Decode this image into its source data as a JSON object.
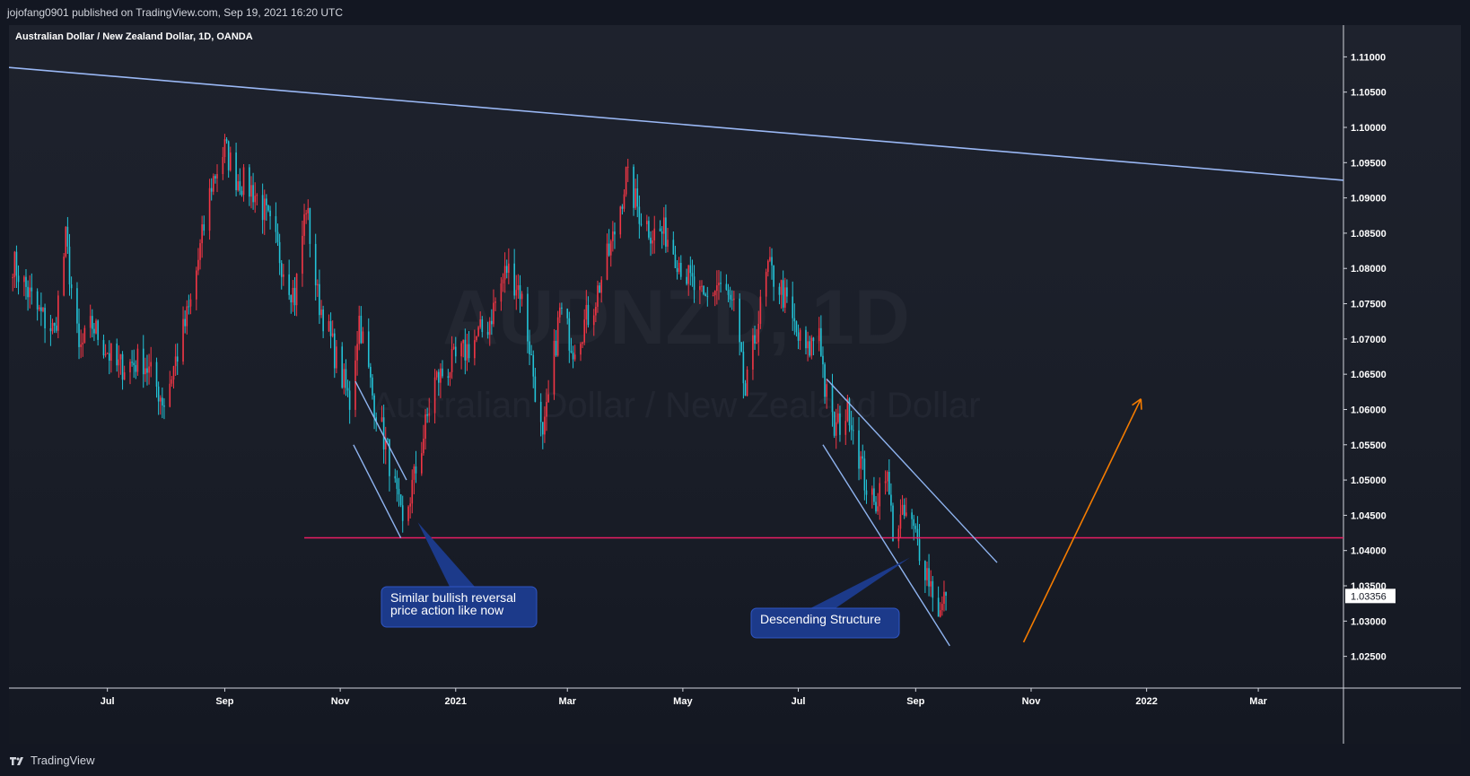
{
  "header": {
    "publish_info": "jojofang0901 published on TradingView.com, Sep 19, 2021 16:20 UTC"
  },
  "footer": {
    "brand": "TradingView"
  },
  "chart_data": {
    "type": "candlestick",
    "title": "Australian Dollar / New Zealand Dollar, 1D, OANDA",
    "watermark_symbol": "AUDNZD, 1D",
    "watermark_name": "Australian Dollar / New Zealand Dollar",
    "x_axis": {
      "ticks": [
        {
          "label": "Jul",
          "date": "2020-07-01"
        },
        {
          "label": "Sep",
          "date": "2020-09-01"
        },
        {
          "label": "Nov",
          "date": "2020-11-01"
        },
        {
          "label": "2021",
          "date": "2021-01-01",
          "bold": true
        },
        {
          "label": "Mar",
          "date": "2021-03-01"
        },
        {
          "label": "May",
          "date": "2021-05-01"
        },
        {
          "label": "Jul",
          "date": "2021-07-01"
        },
        {
          "label": "Sep",
          "date": "2021-09-01"
        },
        {
          "label": "Nov",
          "date": "2021-11-01"
        },
        {
          "label": "2022",
          "date": "2022-01-01",
          "bold": true
        },
        {
          "label": "Mar",
          "date": "2022-03-01"
        }
      ],
      "range": [
        "2020-05-10",
        "2022-04-15"
      ]
    },
    "y_axis": {
      "ticks": [
        "1.02500",
        "1.03000",
        "1.03500",
        "1.04000",
        "1.04500",
        "1.05000",
        "1.05500",
        "1.06000",
        "1.06500",
        "1.07000",
        "1.07500",
        "1.08000",
        "1.08500",
        "1.09000",
        "1.09500",
        "1.10000",
        "1.10500",
        "1.11000"
      ],
      "range": [
        1.0205,
        1.1145
      ]
    },
    "last_price": "1.03356",
    "up_color": "#f23645",
    "down_color": "#22c2d6",
    "anchors": [
      [
        "2020-05-12",
        1.081
      ],
      [
        "2020-05-25",
        1.074
      ],
      [
        "2020-06-03",
        1.071
      ],
      [
        "2020-06-09",
        1.084
      ],
      [
        "2020-06-16",
        1.068
      ],
      [
        "2020-06-23",
        1.072
      ],
      [
        "2020-07-06",
        1.066
      ],
      [
        "2020-07-20",
        1.067
      ],
      [
        "2020-07-31",
        1.061
      ],
      [
        "2020-08-07",
        1.068
      ],
      [
        "2020-08-14",
        1.075
      ],
      [
        "2020-08-25",
        1.092
      ],
      [
        "2020-09-01",
        1.097
      ],
      [
        "2020-09-07",
        1.093
      ],
      [
        "2020-09-16",
        1.091
      ],
      [
        "2020-09-22",
        1.088
      ],
      [
        "2020-10-01",
        1.081
      ],
      [
        "2020-10-08",
        1.076
      ],
      [
        "2020-10-14",
        1.089
      ],
      [
        "2020-10-20",
        1.076
      ],
      [
        "2020-10-29",
        1.068
      ],
      [
        "2020-11-06",
        1.061
      ],
      [
        "2020-11-11",
        1.073
      ],
      [
        "2020-11-18",
        1.062
      ],
      [
        "2020-11-26",
        1.054
      ],
      [
        "2020-12-04",
        1.043
      ],
      [
        "2020-12-14",
        1.055
      ],
      [
        "2020-12-21",
        1.064
      ],
      [
        "2021-01-05",
        1.068
      ],
      [
        "2021-01-18",
        1.072
      ],
      [
        "2021-01-28",
        1.08
      ],
      [
        "2021-02-04",
        1.077
      ],
      [
        "2021-02-09",
        1.069
      ],
      [
        "2021-02-16",
        1.055
      ],
      [
        "2021-02-25",
        1.074
      ],
      [
        "2021-03-04",
        1.069
      ],
      [
        "2021-03-15",
        1.075
      ],
      [
        "2021-03-25",
        1.084
      ],
      [
        "2021-04-01",
        1.093
      ],
      [
        "2021-04-08",
        1.088
      ],
      [
        "2021-04-15",
        1.085
      ],
      [
        "2021-04-22",
        1.085
      ],
      [
        "2021-05-03",
        1.079
      ],
      [
        "2021-05-12",
        1.075
      ],
      [
        "2021-05-20",
        1.078
      ],
      [
        "2021-05-28",
        1.074
      ],
      [
        "2021-06-03",
        1.062
      ],
      [
        "2021-06-08",
        1.07
      ],
      [
        "2021-06-15",
        1.08
      ],
      [
        "2021-06-22",
        1.077
      ],
      [
        "2021-07-01",
        1.07
      ],
      [
        "2021-07-06",
        1.068
      ],
      [
        "2021-07-12",
        1.072
      ],
      [
        "2021-07-15",
        1.063
      ],
      [
        "2021-07-20",
        1.057
      ],
      [
        "2021-07-28",
        1.06
      ],
      [
        "2021-08-05",
        1.05
      ],
      [
        "2021-08-10",
        1.046
      ],
      [
        "2021-08-16",
        1.052
      ],
      [
        "2021-08-20",
        1.043
      ],
      [
        "2021-08-27",
        1.045
      ],
      [
        "2021-09-01",
        1.042
      ],
      [
        "2021-09-07",
        1.037
      ],
      [
        "2021-09-14",
        1.031
      ],
      [
        "2021-09-17",
        1.0336
      ]
    ],
    "drawings": {
      "long_trendline": {
        "color": "#9ab8f5",
        "p1": [
          "2020-05-10",
          1.1085
        ],
        "p2": [
          "2022-04-15",
          1.0925
        ]
      },
      "support_level": {
        "color": "#e91e63",
        "price": 1.0418,
        "from": "2020-10-13"
      },
      "nov_wedge": {
        "color": "#8fb4f0",
        "a1": [
          "2020-11-09",
          1.064
        ],
        "a2": [
          "2020-12-06",
          1.05
        ],
        "b1": [
          "2020-11-08",
          1.055
        ],
        "b2": [
          "2020-12-03",
          1.0418
        ]
      },
      "descending_channel": {
        "color": "#8fb4f0",
        "a1": [
          "2021-07-16",
          1.0643
        ],
        "a2": [
          "2021-10-14",
          1.0383
        ],
        "b1": [
          "2021-07-14",
          1.055
        ],
        "b2": [
          "2021-09-19",
          1.0265
        ]
      },
      "projection_arrow": {
        "color": "#f57c00",
        "from": [
          "2021-10-28",
          1.027
        ],
        "to": [
          "2021-12-29",
          1.0615
        ]
      }
    },
    "annotations": [
      {
        "name": "similar-reversal-callout",
        "lines": [
          "Similar bullish reversal",
          "price action like now"
        ],
        "anchor": [
          "2020-12-12",
          1.044
        ]
      },
      {
        "name": "descending-structure-callout",
        "lines": [
          "Descending Structure"
        ],
        "anchor": [
          "2021-08-29",
          1.039
        ]
      }
    ],
    "callout_color": "#1c3a8a"
  }
}
